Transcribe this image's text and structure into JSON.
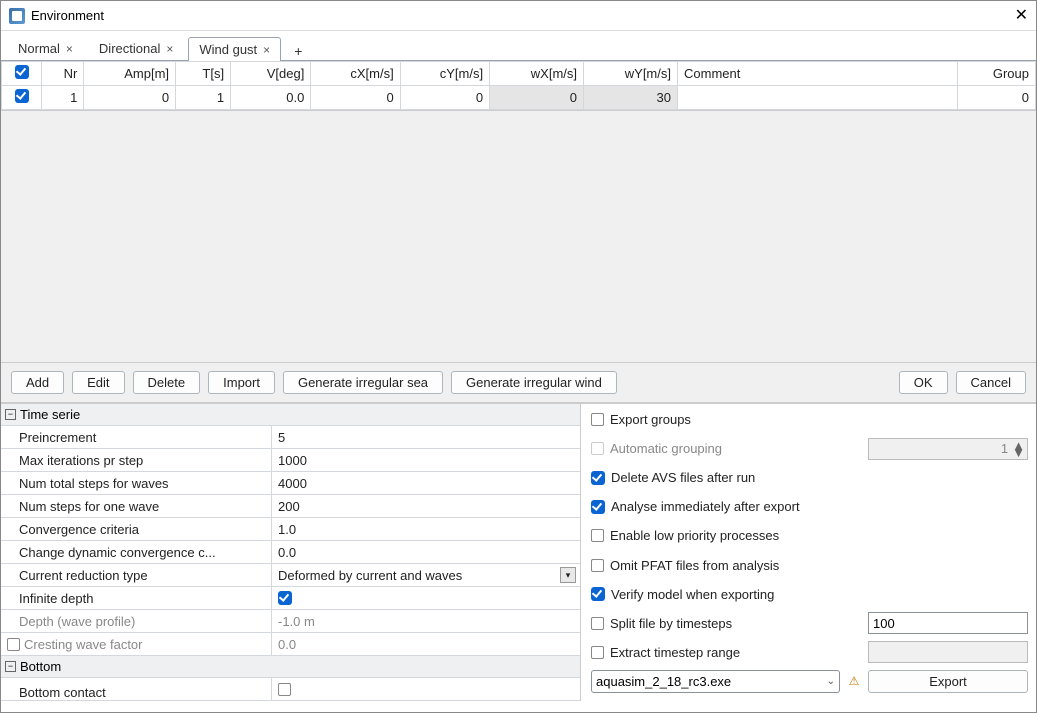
{
  "window": {
    "title": "Environment"
  },
  "tabs": {
    "items": [
      {
        "label": "Normal"
      },
      {
        "label": "Directional"
      },
      {
        "label": "Wind gust"
      }
    ],
    "active_index": 2
  },
  "grid": {
    "headers": {
      "nr": "Nr",
      "amp": "Amp[m]",
      "t": "T[s]",
      "v": "V[deg]",
      "cx": "cX[m/s]",
      "cy": "cY[m/s]",
      "wx": "wX[m/s]",
      "wy": "wY[m/s]",
      "comment": "Comment",
      "group": "Group"
    },
    "rows": [
      {
        "nr": "1",
        "amp": "0",
        "t": "1",
        "v": "0.0",
        "cx": "0",
        "cy": "0",
        "wx": "0",
        "wy": "30",
        "comment": "",
        "group": "0"
      }
    ]
  },
  "buttons": {
    "add": "Add",
    "edit": "Edit",
    "delete": "Delete",
    "import": "Import",
    "gen_sea": "Generate irregular sea",
    "gen_wind": "Generate irregular wind",
    "ok": "OK",
    "cancel": "Cancel"
  },
  "timeserie": {
    "header": "Time serie",
    "preincrement_label": "Preincrement",
    "preincrement_val": "5",
    "maxiter_label": "Max iterations pr step",
    "maxiter_val": "1000",
    "totalsteps_label": "Num total steps for waves",
    "totalsteps_val": "4000",
    "onesteps_label": "Num steps for one wave",
    "onesteps_val": "200",
    "conv_label": "Convergence criteria",
    "conv_val": "1.0",
    "dynconv_label": "Change dynamic convergence c...",
    "dynconv_val": "0.0",
    "redtype_label": "Current reduction type",
    "redtype_val": "Deformed by current and waves",
    "infdepth_label": "Infinite depth",
    "depth_label": "Depth (wave profile)",
    "depth_val": "-1.0 m",
    "cresting_label": "Cresting wave factor",
    "cresting_val": "0.0",
    "bottom_header": "Bottom",
    "bottom_contact_label": "Bottom contact"
  },
  "export": {
    "export_groups": "Export groups",
    "auto_grouping": "Automatic grouping",
    "auto_grouping_val": "1",
    "delete_avs": "Delete AVS files after run",
    "analyse": "Analyse immediately after export",
    "lowprio": "Enable low priority processes",
    "omit_pfat": "Omit PFAT files from analysis",
    "verify": "Verify model when exporting",
    "split": "Split file by timesteps",
    "split_val": "100",
    "extract": "Extract timestep range",
    "exe": "aquasim_2_18_rc3.exe",
    "export_btn": "Export"
  }
}
